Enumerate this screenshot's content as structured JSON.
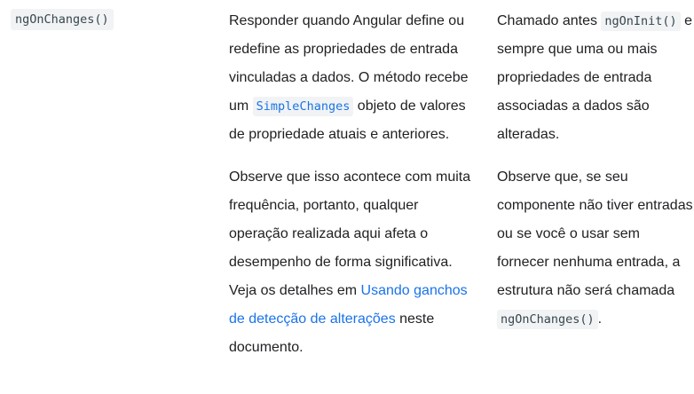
{
  "hook": {
    "name": "ngOnChanges()"
  },
  "purpose": {
    "p1_part1": "Responder quando Angular define ou redefine as propriedades de entrada vinculadas a dados. O método recebe um ",
    "p1_code": "SimpleChanges",
    "p1_part2": " objeto de valores de propriedade atuais e anteriores.",
    "p2_part1": "Observe que isso acontece com muita frequência, portanto, qualquer operação realizada aqui afeta o desempenho de forma significativa. Veja os detalhes em ",
    "p2_link": "Usando ganchos de detecção de alterações",
    "p2_part2": " neste documento."
  },
  "timing": {
    "p1_part1": "Chamado antes ",
    "p1_code": "ngOnInit()",
    "p1_part2": " e sempre que uma ou mais propriedades de entrada associadas a dados são alteradas.",
    "p2_part1": "Observe que, se seu componente não tiver entradas ou se você o usar sem fornecer nenhuma entrada, a estrutura não será chamada ",
    "p2_code": "ngOnChanges()",
    "p2_part2": "."
  }
}
